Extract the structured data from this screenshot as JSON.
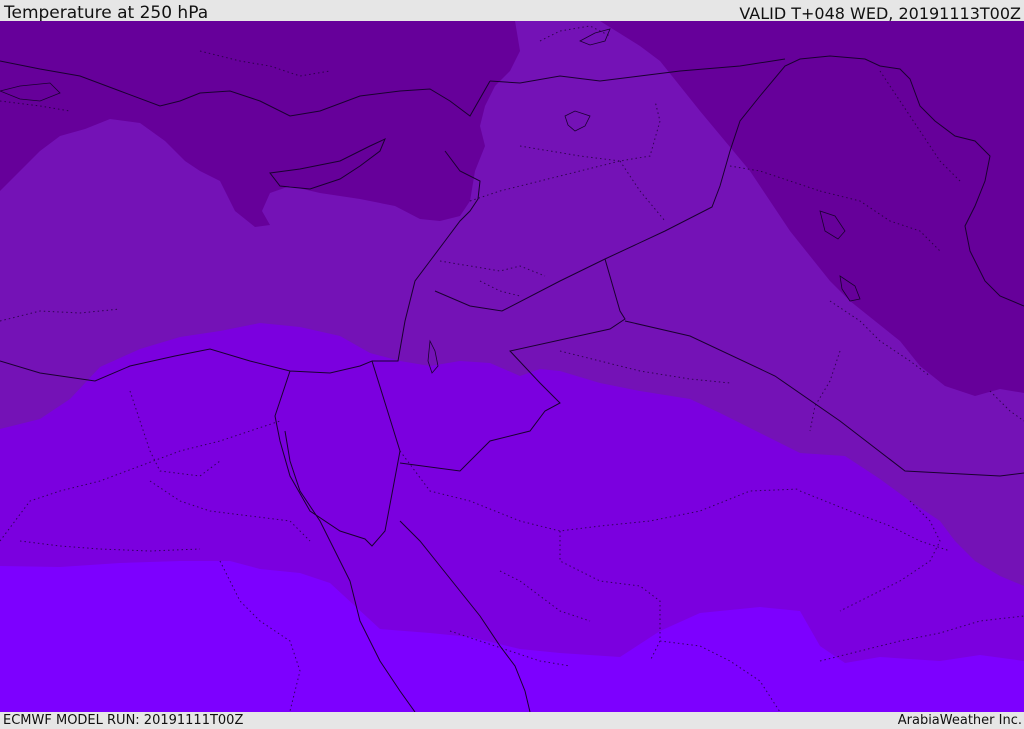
{
  "header": {
    "title": "Temperature at 250 hPa",
    "valid_time": "VALID T+048 WED, 20191113T00Z"
  },
  "footer": {
    "model_run": "ECMWF MODEL RUN: 20191111T00Z",
    "credit": "ArabiaWeather Inc."
  },
  "colors": {
    "band_coldest": "#66009a",
    "band_cold": "#7412b6",
    "band_mid": "#7b00df",
    "band_warm": "#7d00ff",
    "border_line": "#1a0030",
    "frame_bg": "#e6e6e6"
  }
}
